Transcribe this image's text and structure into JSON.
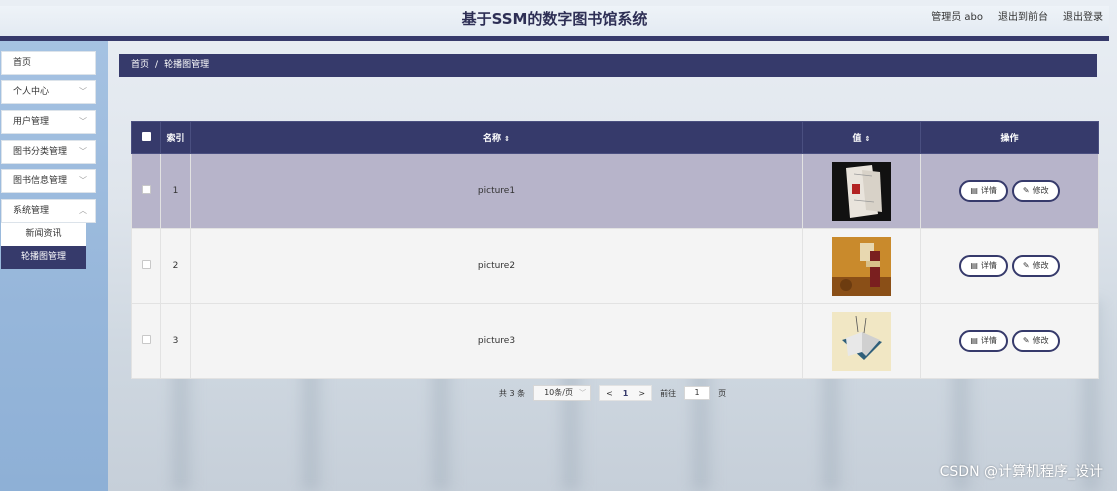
{
  "header": {
    "title": "基于SSM的数字图书馆系统",
    "user_label": "管理员 abo",
    "front_link": "退出到前台",
    "logout_link": "退出登录"
  },
  "sidebar": {
    "items": [
      {
        "label": "首页",
        "has_chevron": false
      },
      {
        "label": "个人中心",
        "has_chevron": true
      },
      {
        "label": "用户管理",
        "has_chevron": true
      },
      {
        "label": "图书分类管理",
        "has_chevron": true
      },
      {
        "label": "图书信息管理",
        "has_chevron": true
      },
      {
        "label": "系统管理",
        "has_chevron": true
      }
    ],
    "subitems": [
      {
        "label": "新闻资讯",
        "active": false
      },
      {
        "label": "轮播图管理",
        "active": true
      }
    ]
  },
  "breadcrumb": {
    "home": "首页",
    "separator": "/",
    "current": "轮播图管理"
  },
  "table": {
    "columns": {
      "index": "索引",
      "name": "名称",
      "value": "值",
      "actions": "操作"
    },
    "rows": [
      {
        "index": "1",
        "name": "picture1",
        "highlighted": true
      },
      {
        "index": "2",
        "name": "picture2",
        "highlighted": false
      },
      {
        "index": "3",
        "name": "picture3",
        "highlighted": false
      }
    ],
    "detail_label": "详情",
    "edit_label": "修改"
  },
  "pagination": {
    "total_text": "共 3 条",
    "page_size": "10条/页",
    "prev": "<",
    "current_page": "1",
    "next": ">",
    "goto_label": "前往",
    "goto_value": "1",
    "page_suffix": "页"
  },
  "watermark": "CSDN @计算机程序_设计",
  "colors": {
    "primary": "#363a6b",
    "row_highlight": "#b7b4ca",
    "sidebar": "#9ab8db"
  }
}
